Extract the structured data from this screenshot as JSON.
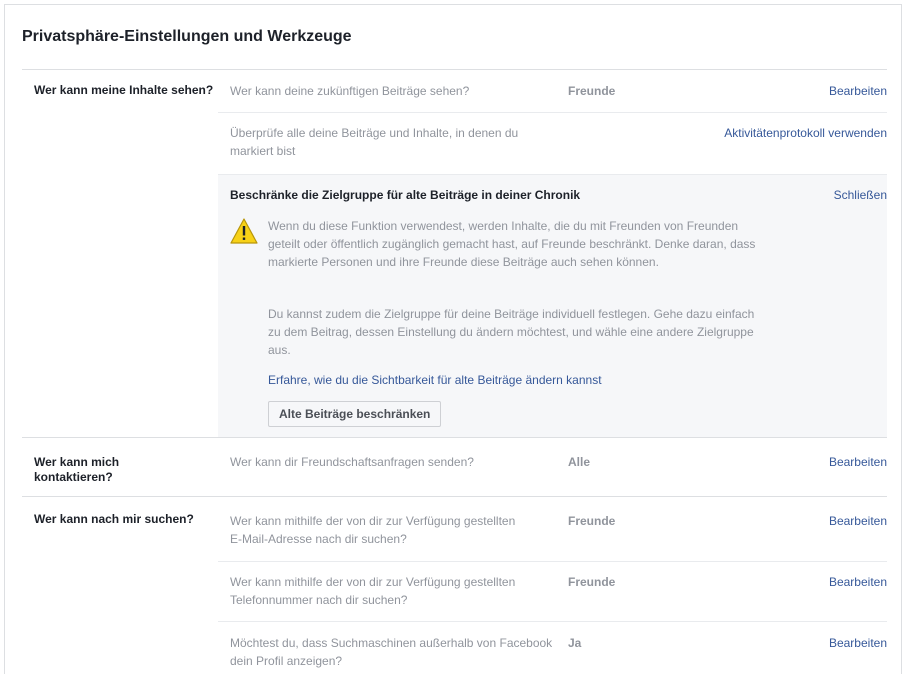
{
  "page_title": "Privatsphäre-Einstellungen und Werkzeuge",
  "sections": [
    {
      "label": "Wer kann meine Inhalte sehen?",
      "rows": [
        {
          "question": "Wer kann deine zukünftigen Beiträge sehen?",
          "value": "Freunde",
          "action": "Bearbeiten"
        },
        {
          "question": "Überprüfe alle deine Beiträge und Inhalte, in denen du markiert bist",
          "value": "",
          "action": "Aktivitätenprotokoll verwenden"
        }
      ],
      "expanded": {
        "title": "Beschränke die Zielgruppe für alte Beiträge in deiner Chronik",
        "close": "Schließen",
        "warning_icon": "warning-triangle-icon",
        "paragraph1": "Wenn du diese Funktion verwendest, werden Inhalte, die du mit Freunden von Freunden geteilt oder öffentlich zugänglich gemacht hast, auf Freunde beschränkt. Denke daran, dass markierte Personen und ihre Freunde diese Beiträge auch sehen können.",
        "paragraph2": "Du kannst zudem die Zielgruppe für deine Beiträge individuell festlegen. Gehe dazu einfach zu dem Beitrag, dessen Einstellung du ändern möchtest, und wähle eine andere Zielgruppe aus.",
        "learn_link": "Erfahre, wie du die Sichtbarkeit für alte Beiträge ändern kannst",
        "button": "Alte Beiträge beschränken"
      }
    },
    {
      "label": "Wer kann mich kontaktieren?",
      "rows": [
        {
          "question": "Wer kann dir Freundschaftsanfragen senden?",
          "value": "Alle",
          "action": "Bearbeiten"
        }
      ]
    },
    {
      "label": "Wer kann nach mir suchen?",
      "rows": [
        {
          "question": "Wer kann mithilfe der von dir zur Verfügung gestellten E-Mail-Adresse nach dir suchen?",
          "value": "Freunde",
          "action": "Bearbeiten"
        },
        {
          "question": "Wer kann mithilfe der von dir zur Verfügung gestellten Telefonnummer nach dir suchen?",
          "value": "Freunde",
          "action": "Bearbeiten"
        },
        {
          "question": "Möchtest du, dass Suchmaschinen außerhalb von Facebook dein Profil anzeigen?",
          "value": "Ja",
          "action": "Bearbeiten"
        }
      ]
    }
  ],
  "colors": {
    "link": "#365899",
    "muted": "#90949c",
    "text": "#1d2129",
    "panel": "#f6f7f9",
    "warning": "#f7d117"
  }
}
